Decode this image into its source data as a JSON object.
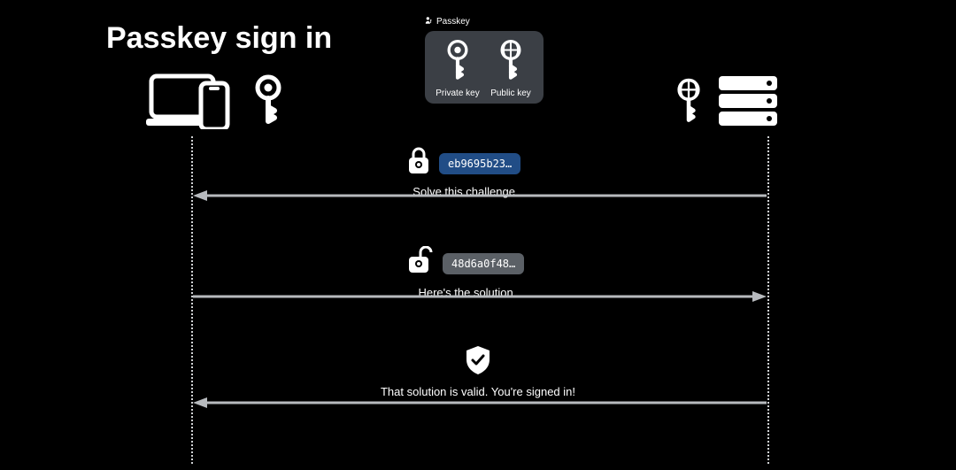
{
  "title": "Passkey sign in",
  "badge": {
    "label": "Passkey",
    "private_key_label": "Private key",
    "public_key_label": "Public key"
  },
  "row1": {
    "chip": "eb9695b23…",
    "caption": "Solve this challenge"
  },
  "row2": {
    "chip": "48d6a0f48…",
    "caption": "Here's the solution"
  },
  "row3": {
    "caption": "That solution is valid. You're signed in!"
  }
}
